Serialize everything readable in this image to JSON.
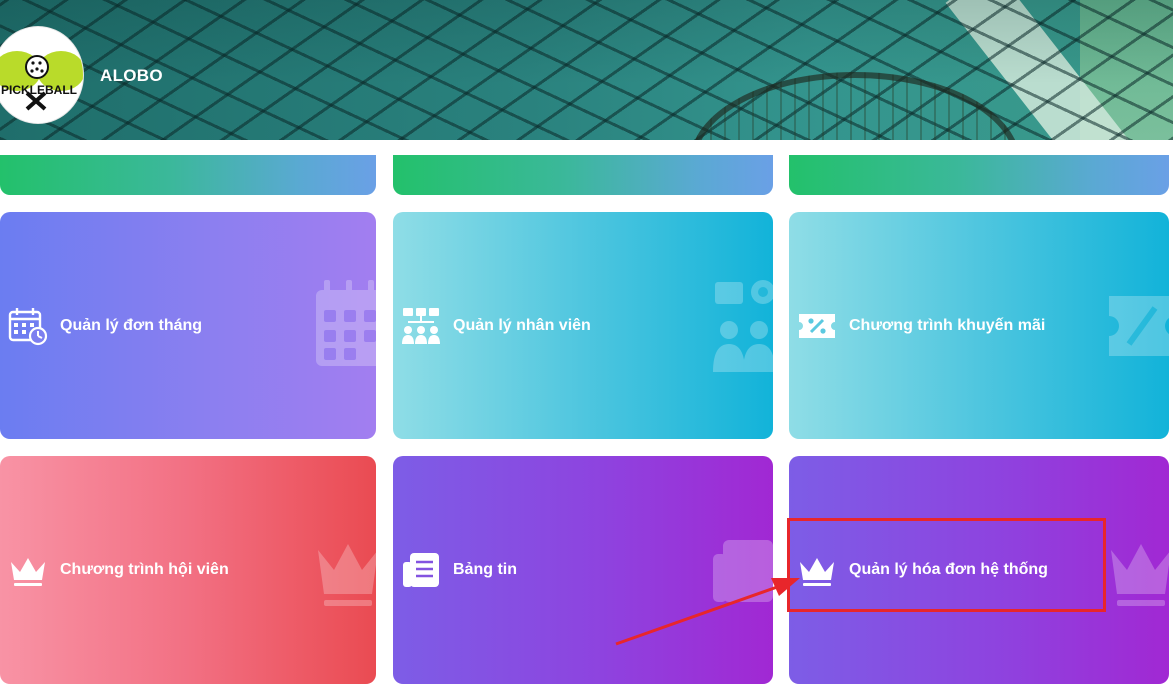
{
  "header": {
    "brand_name": "ALOBO",
    "logo_text": "PICKLEBALL"
  },
  "cards": [
    {
      "label": "Quản lý đơn tháng",
      "icon": "calendar-clock-icon"
    },
    {
      "label": "Quản lý nhân viên",
      "icon": "staff-org-icon"
    },
    {
      "label": "Chương trình khuyến mãi",
      "icon": "discount-ticket-icon"
    },
    {
      "label": "Chương trình hội viên",
      "icon": "crown-icon"
    },
    {
      "label": "Bảng tin",
      "icon": "newspaper-icon"
    },
    {
      "label": "Quản lý hóa đơn hệ thống",
      "icon": "crown-icon"
    }
  ],
  "colors": {
    "strip": "#3bb89a",
    "card_blue_purple": "#8b7ff0",
    "card_cyan": "#4fc6df",
    "card_red": "#f27083",
    "card_purple": "#8e43df",
    "annotation": "#e8262b"
  },
  "annotation": {
    "target": "Quản lý hóa đơn hệ thống",
    "type": "highlight-box-with-arrow"
  }
}
